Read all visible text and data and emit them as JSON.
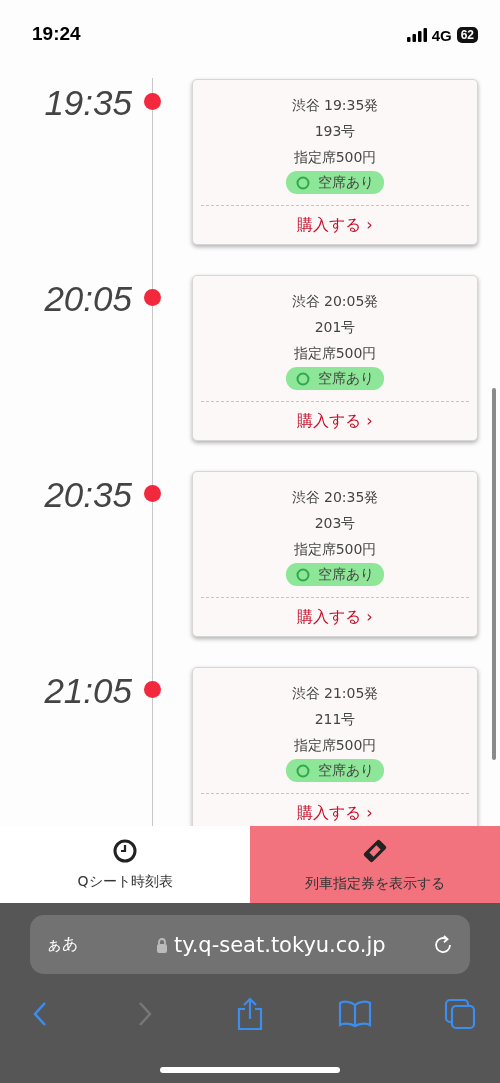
{
  "status_bar": {
    "time": "19:24",
    "network": "4G",
    "battery": "62"
  },
  "trains": [
    {
      "time": "19:35",
      "departure": "渋谷 19:35発",
      "number": "193号",
      "price": "指定席500円",
      "availability": "空席あり",
      "action": "購入する ›"
    },
    {
      "time": "20:05",
      "departure": "渋谷 20:05発",
      "number": "201号",
      "price": "指定席500円",
      "availability": "空席あり",
      "action": "購入する ›"
    },
    {
      "time": "20:35",
      "departure": "渋谷 20:35発",
      "number": "203号",
      "price": "指定席500円",
      "availability": "空席あり",
      "action": "購入する ›"
    },
    {
      "time": "21:05",
      "departure": "渋谷 21:05発",
      "number": "211号",
      "price": "指定席500円",
      "availability": "空席あり",
      "action": "購入する ›"
    }
  ],
  "tab_bar": [
    {
      "label": "Qシート時刻表",
      "kind": "timetable"
    },
    {
      "label": "列車指定券を表示する",
      "kind": "ticket"
    }
  ],
  "browser": {
    "text_size": "ぁあ",
    "url": "ty.q-seat.tokyu.co.jp",
    "forward_disabled": true
  }
}
